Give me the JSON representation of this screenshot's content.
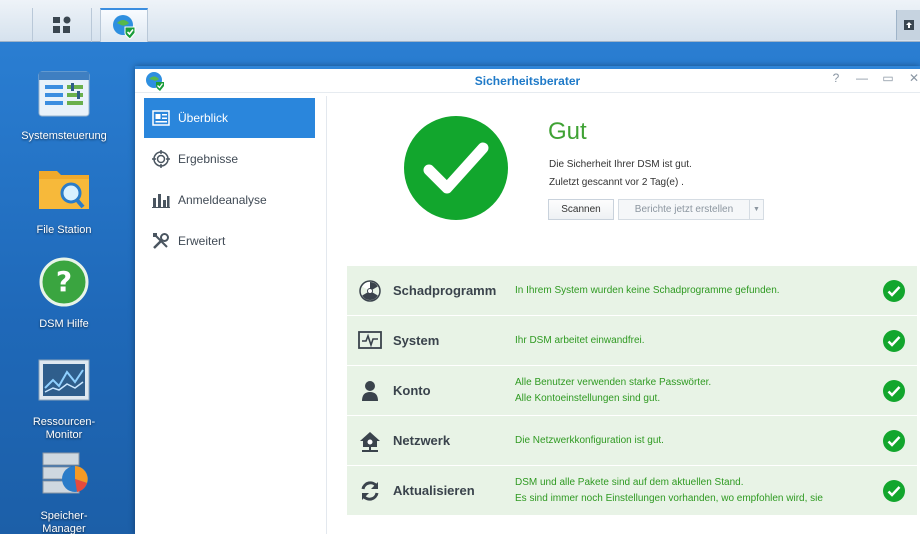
{
  "taskbar": {
    "main_menu_icon": "grid-icon",
    "active_app_icon": "security-advisor-icon",
    "notification_icon": "upload-icon"
  },
  "desktop": {
    "icons": [
      {
        "label": "Systemsteuerung",
        "icon": "control-panel-icon"
      },
      {
        "label": "File Station",
        "icon": "folder-search-icon"
      },
      {
        "label": "DSM Hilfe",
        "icon": "help-icon"
      },
      {
        "label": "Ressourcen-\nMonitor",
        "icon": "resource-monitor-icon"
      },
      {
        "label": "Speicher-\nManager",
        "icon": "storage-manager-icon"
      }
    ]
  },
  "window": {
    "title": "Sicherheitsberater",
    "controls": [
      "?",
      "—",
      "▭",
      "✕"
    ],
    "sidebar": {
      "items": [
        {
          "label": "Überblick",
          "icon": "overview-icon",
          "active": true
        },
        {
          "label": "Ergebnisse",
          "icon": "target-icon",
          "active": false
        },
        {
          "label": "Anmeldeanalyse",
          "icon": "bar-chart-icon",
          "active": false
        },
        {
          "label": "Erweitert",
          "icon": "tools-icon",
          "active": false
        }
      ]
    },
    "overview": {
      "status": "Gut",
      "line1": "Die Sicherheit Ihrer DSM ist gut.",
      "line2": "Zuletzt gescannt vor 2 Tag(e) .",
      "scan_button": "Scannen",
      "report_button": "Berichte jetzt erstellen"
    },
    "results": [
      {
        "label": "Schadprogramm",
        "icon": "radiation-icon",
        "desc": [
          "In Ihrem System wurden keine Schadprogramme gefunden."
        ]
      },
      {
        "label": "System",
        "icon": "monitor-pulse-icon",
        "desc": [
          "Ihr DSM arbeitet einwandfrei."
        ]
      },
      {
        "label": "Konto",
        "icon": "user-icon",
        "desc": [
          "Alle Benutzer verwenden starke Passwörter.",
          "Alle Kontoeinstellungen sind gut."
        ]
      },
      {
        "label": "Netzwerk",
        "icon": "home-network-icon",
        "desc": [
          "Die Netzwerkkonfiguration ist gut."
        ]
      },
      {
        "label": "Aktualisieren",
        "icon": "refresh-icon",
        "desc": [
          "DSM und alle Pakete sind auf dem aktuellen Stand.",
          "Es sind immer noch Einstellungen vorhanden, wo empfohlen wird, sie"
        ]
      }
    ],
    "colors": {
      "accent": "#2a86dc",
      "ok_green": "#12a62d",
      "text_green": "#2f9a22"
    }
  }
}
